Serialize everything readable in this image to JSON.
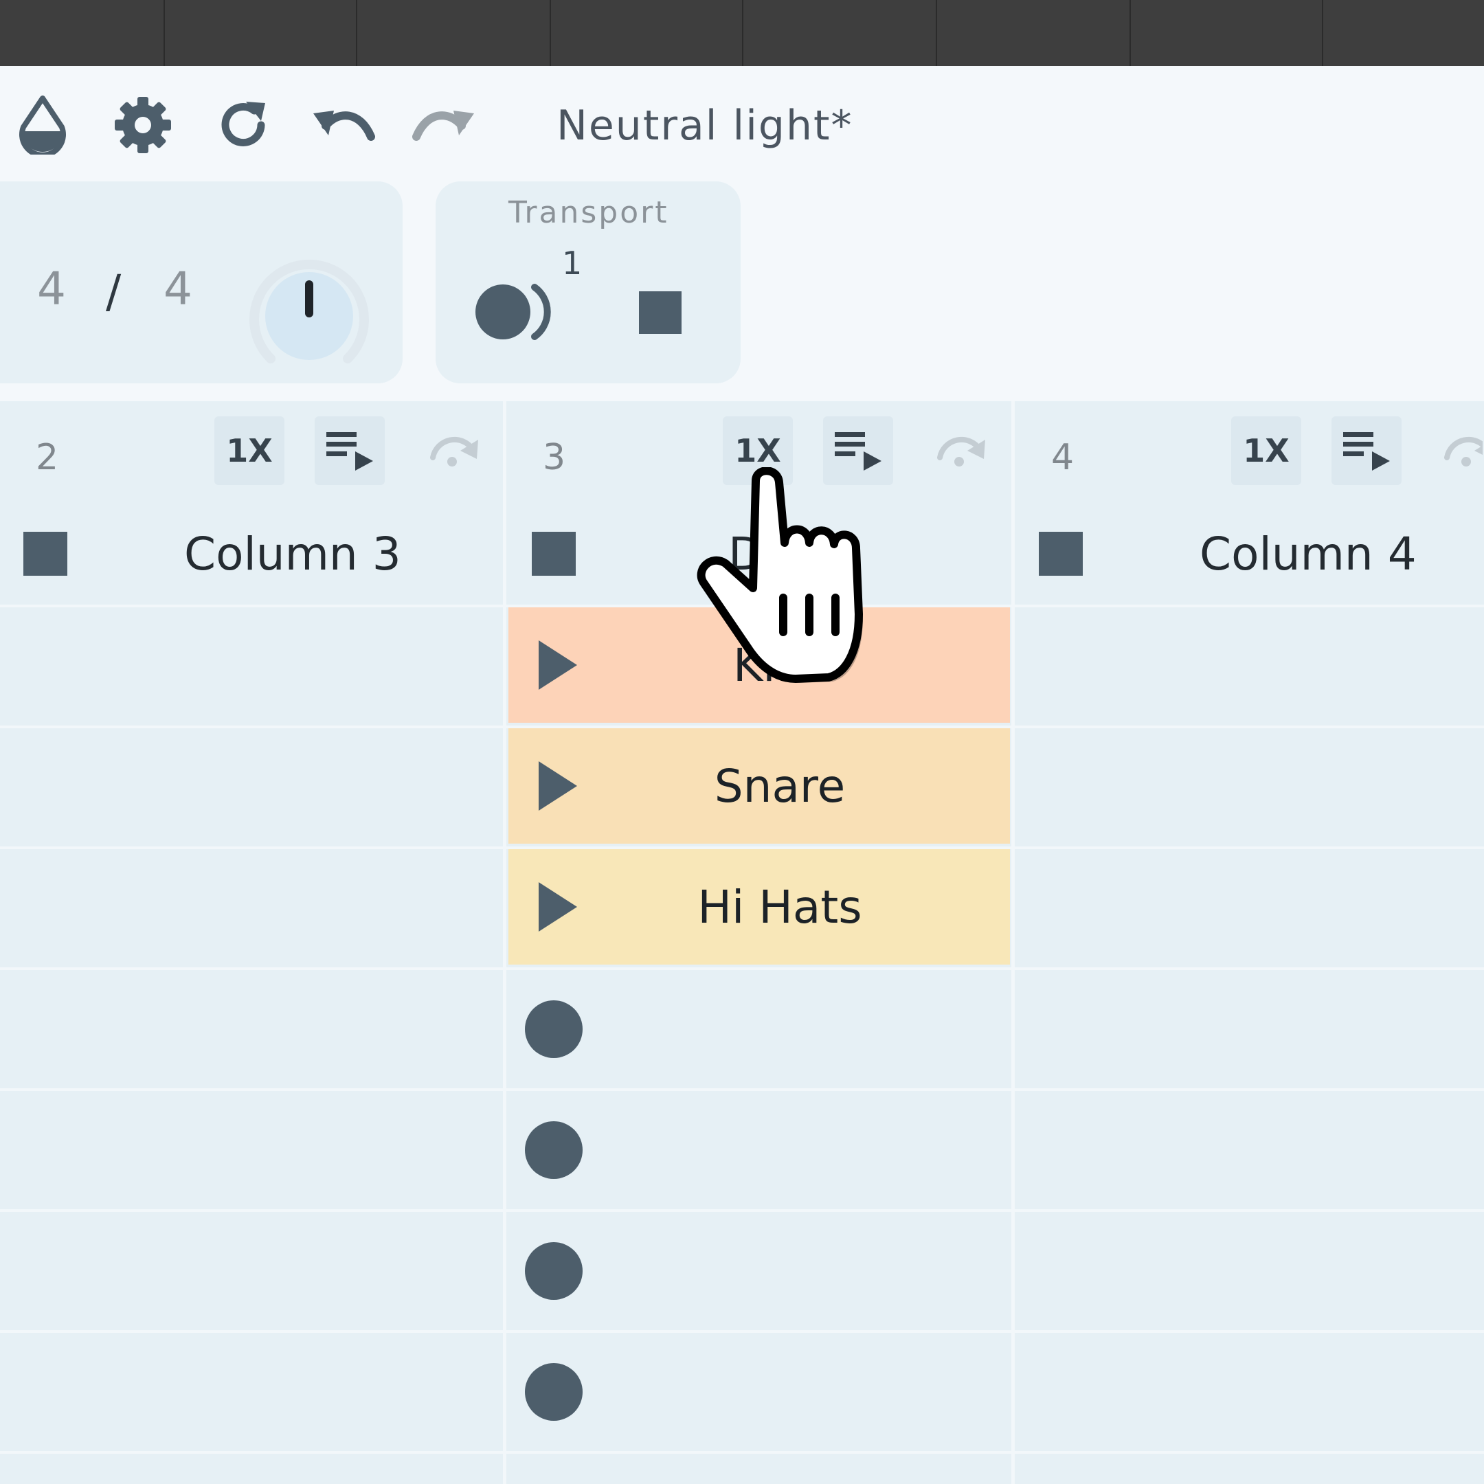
{
  "toolbar": {
    "icons": [
      "drop-icon",
      "gear-icon",
      "refresh-icon",
      "undo-icon",
      "redo-icon"
    ],
    "theme_name": "Neutral light*"
  },
  "time_signature": {
    "numerator": "4",
    "separator": "/",
    "denominator": "4"
  },
  "transport": {
    "title": "Transport",
    "count": "1"
  },
  "columns": [
    {
      "number": "2",
      "title": "Column 3",
      "rate": "1X"
    },
    {
      "number": "3",
      "title": "D",
      "rate": "1X"
    },
    {
      "number": "4",
      "title": "Column 4",
      "rate": "1X"
    }
  ],
  "clips": [
    {
      "name": "Kick",
      "color": "#fdd3b8"
    },
    {
      "name": "Snare",
      "color": "#f9e0b6"
    },
    {
      "name": "Hi Hats",
      "color": "#f8e7b8"
    }
  ],
  "colors": {
    "background": "#e6f0f5",
    "toolbar": "#f4f8fb",
    "icon": "#4d5e6b",
    "topbar": "#3e3e3e"
  }
}
